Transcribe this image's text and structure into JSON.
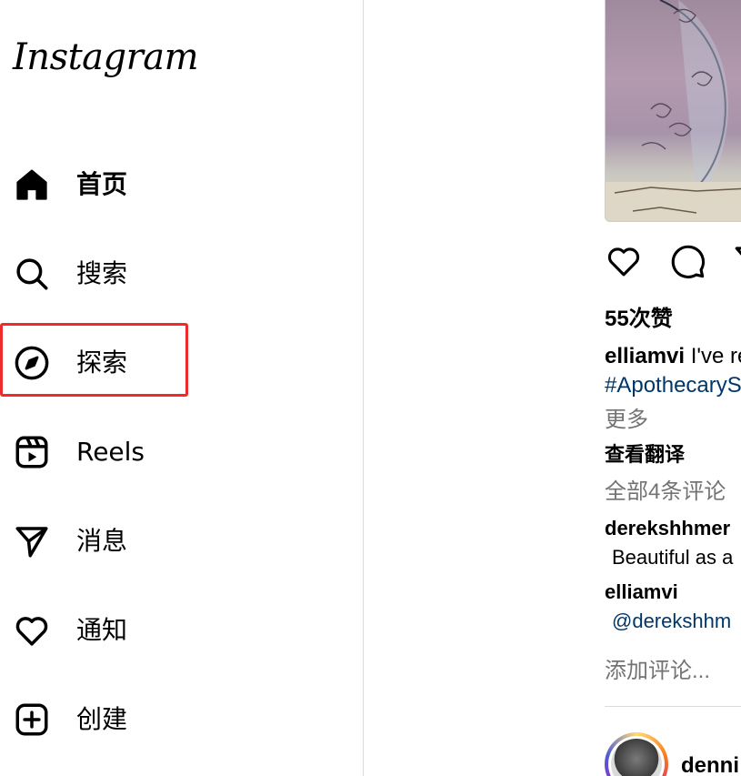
{
  "app": {
    "logo_text": "Instagram"
  },
  "sidebar": {
    "items": [
      {
        "label": "首页",
        "icon": "home-icon",
        "active": true
      },
      {
        "label": "搜索",
        "icon": "search-icon"
      },
      {
        "label": "探索",
        "icon": "compass-icon",
        "highlighted": true
      },
      {
        "label": "Reels",
        "icon": "reels-icon"
      },
      {
        "label": "消息",
        "icon": "paper-plane-icon"
      },
      {
        "label": "通知",
        "icon": "heart-icon"
      },
      {
        "label": "创建",
        "icon": "plus-square-icon"
      }
    ],
    "highlight_color": "#ee2a2a"
  },
  "post": {
    "likes": "55次赞",
    "caption_user": "elliamvi",
    "caption_text": "I've re",
    "hashtag": "#ApothecaryS",
    "more": "更多",
    "translate": "查看翻译",
    "all_comments": "全部4条评论",
    "comments": [
      {
        "user": "derekshhmer",
        "text": "Beautiful as a"
      },
      {
        "user": "elliamvi",
        "text": "@derekshhm"
      }
    ],
    "add_comment_placeholder": "添加评论...",
    "next_post_user": "denni"
  },
  "colors": {
    "link": "#00376b",
    "muted": "#737373",
    "border": "#dbdbdb"
  }
}
